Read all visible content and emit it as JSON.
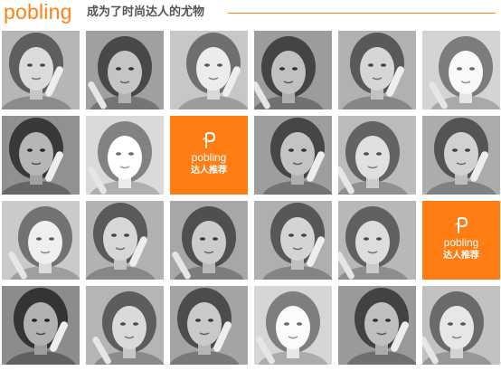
{
  "header": {
    "brand": "pobling",
    "slogan": "成为了时尚达人的尤物"
  },
  "colors": {
    "accent": "#ff8214",
    "promo_background": "#ff7d13",
    "slogan_text": "#555555"
  },
  "promo_tiles": [
    {
      "logo_icon": "pobling-logo-icon",
      "brand": "pobling",
      "tagline": "达人推荐"
    },
    {
      "logo_icon": "pobling-logo-icon",
      "brand": "pobling",
      "tagline": "达人推荐"
    }
  ],
  "photos": [
    {
      "tone": "#a4a4a4"
    },
    {
      "tone": "#8e8e8e"
    },
    {
      "tone": "#b5b5b5"
    },
    {
      "tone": "#8a8a8a"
    },
    {
      "tone": "#9f9f9f"
    },
    {
      "tone": "#c2c2c2"
    },
    {
      "tone": "#7f7f7f"
    },
    {
      "tone": "#c8c8c8"
    },
    {
      "tone": "#8c8c8c"
    },
    {
      "tone": "#a9a9a9"
    },
    {
      "tone": "#9a9a9a"
    },
    {
      "tone": "#b8b8b8"
    },
    {
      "tone": "#a0a0a0"
    },
    {
      "tone": "#959595"
    },
    {
      "tone": "#9d9d9d"
    },
    {
      "tone": "#a6a6a6"
    },
    {
      "tone": "#7a7a7a"
    },
    {
      "tone": "#a3a3a3"
    },
    {
      "tone": "#929292"
    },
    {
      "tone": "#c4c4c4"
    },
    {
      "tone": "#888888"
    },
    {
      "tone": "#b0b0b0"
    }
  ]
}
